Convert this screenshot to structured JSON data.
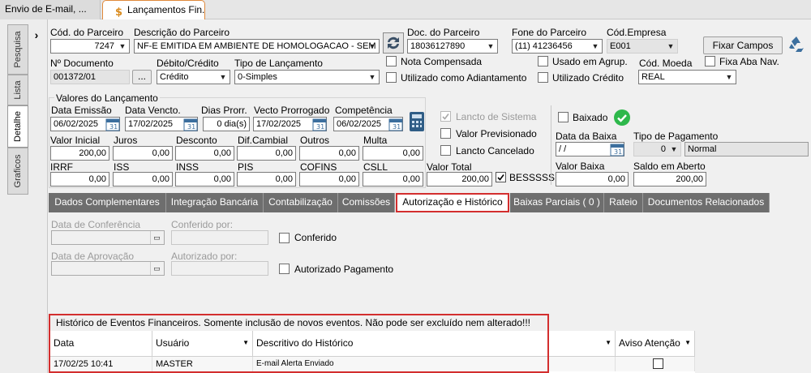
{
  "tabs": [
    {
      "label": "Envio de E-mail, ..."
    },
    {
      "label": "Lançamentos Fin..."
    }
  ],
  "sidebar": {
    "items": [
      {
        "label": "Pesquisa"
      },
      {
        "label": "Lista"
      },
      {
        "label": "Detalhe"
      },
      {
        "label": "Graficos"
      }
    ]
  },
  "header": {
    "cod_parceiro_label": "Cód. do Parceiro",
    "cod_parceiro": "7247",
    "descricao_label": "Descrição do Parceiro",
    "descricao": "NF-E EMITIDA EM AMBIENTE DE HOMOLOGACAO - SEM",
    "doc_label": "Doc. do Parceiro",
    "doc": "18036127890",
    "fone_label": "Fone do Parceiro",
    "fone": "(11) 41236456",
    "empresa_label": "Cód.Empresa",
    "empresa": "E001",
    "fixar_label": "Fixar Campos",
    "num_doc_label": "Nº Documento",
    "num_doc": "001372/01",
    "dots": "...",
    "debcred_label": "Débito/Crédito",
    "debcred": "Crédito",
    "tipo_label": "Tipo de Lançamento",
    "tipo": "0-Simples",
    "nota_comp": "Nota Compensada",
    "adiantamento": "Utilizado como Adiantamento",
    "usado_agrup": "Usado em Agrup.",
    "utilizado_credito": "Utilizado Crédito",
    "moeda_label": "Cód. Moeda",
    "moeda": "REAL",
    "fixa_aba": "Fixa Aba Nav."
  },
  "valores": {
    "title": "Valores do Lançamento",
    "emissao_label": "Data Emissão",
    "emissao": "06/02/2025",
    "vencto_label": "Data Vencto.",
    "vencto": "17/02/2025",
    "prorr_label": "Dias Prorr.",
    "prorr": "0 dia(s)",
    "vprorr_label": "Vecto Prorrogado",
    "vprorr": "17/02/2025",
    "comp_label": "Competência",
    "comp": "06/02/2025",
    "inicial_label": "Valor Inicial",
    "inicial": "200,00",
    "juros_label": "Juros",
    "juros": "0,00",
    "desconto_label": "Desconto",
    "desconto": "0,00",
    "difcamb_label": "Dif.Cambial",
    "difcamb": "0,00",
    "outros_label": "Outros",
    "outros": "0,00",
    "multa_label": "Multa",
    "multa": "0,00",
    "irrf_label": "IRRF",
    "irrf": "0,00",
    "iss_label": "ISS",
    "iss": "0,00",
    "inss_label": "INSS",
    "inss": "0,00",
    "pis_label": "PIS",
    "pis": "0,00",
    "cofins_label": "COFINS",
    "cofins": "0,00",
    "csll_label": "CSLL",
    "csll": "0,00",
    "total_label": "Valor Total",
    "total": "200,00",
    "bes_label": "BESSSSS",
    "lancto_sistema": "Lancto de Sistema",
    "valor_prev": "Valor Previsionado",
    "lancto_cancel": "Lancto Cancelado"
  },
  "baixa": {
    "baixado": "Baixado",
    "data_label": "Data da Baixa",
    "data": " / /",
    "tipo_label": "Tipo de Pagamento",
    "tipo_code": "0",
    "tipo": "Normal",
    "valor_label": "Valor Baixa",
    "valor": "0,00",
    "saldo_label": "Saldo em Aberto",
    "saldo": "200,00"
  },
  "subtabs": [
    {
      "label": "Dados Complementares"
    },
    {
      "label": "Integração Bancária"
    },
    {
      "label": "Contabilização"
    },
    {
      "label": "Comissões"
    },
    {
      "label": "Autorização e Histórico"
    },
    {
      "label": "Baixas Parciais ( 0 )"
    },
    {
      "label": "Rateio"
    },
    {
      "label": "Documentos Relacionados"
    }
  ],
  "autorizacao": {
    "conf_label": "Data de Conferência",
    "conf_por_label": "Conferido por:",
    "conferido": "Conferido",
    "aprov_label": "Data de Aprovação",
    "aut_por_label": "Autorizado por:",
    "aut_pag": "Autorizado Pagamento"
  },
  "historico": {
    "title": "Histórico de Eventos Financeiros. Somente inclusão de novos eventos. Não pode ser excluído nem alterado!!!",
    "columns": [
      "Data",
      "Usuário",
      "Descritivo do Histórico",
      "Aviso Atenção"
    ],
    "rows": [
      {
        "data": "17/02/25 10:41",
        "usuario": "MASTER",
        "descricao": "E-mail Alerta Enviado",
        "aviso": false
      }
    ]
  },
  "colors": {
    "accent_red": "#d32e2e",
    "tab_orange": "#e0893a",
    "tab_gray": "#6e6e6e",
    "ok_green": "#2eb84b"
  }
}
